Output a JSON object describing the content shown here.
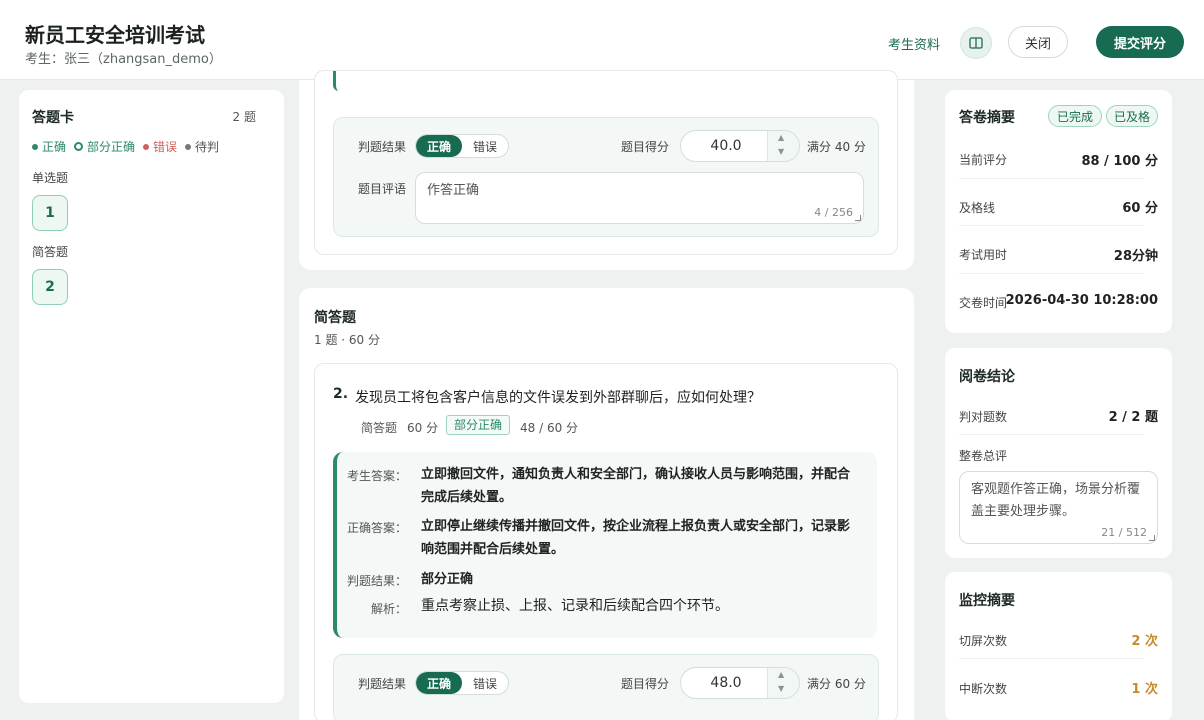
{
  "header": {
    "title": "新员工安全培训考试",
    "subtitle": "考生：张三（zhangsan_demo）",
    "profile_link": "考生资料",
    "close_label": "关闭",
    "submit_label": "提交评分"
  },
  "sidebar": {
    "title": "答题卡",
    "count": "2 题",
    "legend": [
      {
        "label": "正确",
        "color": "#2d8a66"
      },
      {
        "label": "部分正确",
        "color": "#2d8a66"
      },
      {
        "label": "错误",
        "color": "#d0605a"
      },
      {
        "label": "待判",
        "color": "#777777"
      }
    ],
    "sections": [
      {
        "title": "单选题",
        "number": "1"
      },
      {
        "title": "简答题",
        "number": "2"
      }
    ]
  },
  "q1_grading": {
    "result_label": "判题结果",
    "correct": "正确",
    "wrong": "错误",
    "score_label": "题目得分",
    "score_value": "40.0",
    "full_score": "满分 40 分",
    "comment_label": "题目评语",
    "comment_text": "作答正确",
    "comment_count": "4 / 256"
  },
  "short_section": {
    "title": "简答题",
    "meta": "1 题 · 60 分"
  },
  "q2": {
    "number": "2.",
    "text": "发现员工将包含客户信息的文件误发到外部群聊后，应如何处理？",
    "type": "简答题",
    "points": "60 分",
    "status_tag": "部分正确",
    "score": "48 / 60 分",
    "student_answer_label": "考生答案：",
    "student_answer": "立即撤回文件，通知负责人和安全部门，确认接收人员与影响范围，并配合完成后续处置。",
    "correct_answer_label": "正确答案：",
    "correct_answer": "立即停止继续传播并撤回文件，按企业流程上报负责人或安全部门，记录影响范围并配合后续处置。",
    "judge_label": "判题结果：",
    "judge_value": "部分正确",
    "analysis_label": "解析：",
    "analysis": "重点考察止损、上报、记录和后续配合四个环节。"
  },
  "q2_grading": {
    "result_label": "判题结果",
    "correct": "正确",
    "wrong": "错误",
    "score_label": "题目得分",
    "score_value": "48.0",
    "full_score": "满分 60 分"
  },
  "summary": {
    "title": "答卷摘要",
    "tag_done": "已完成",
    "tag_pass": "已及格",
    "rows": [
      {
        "label": "当前评分",
        "value": "88 / 100 分"
      },
      {
        "label": "及格线",
        "value": "60 分"
      },
      {
        "label": "考试用时",
        "value": "28分钟"
      },
      {
        "label": "交卷时间",
        "value": "2026-04-30 10:28:00"
      }
    ]
  },
  "conclusion": {
    "title": "阅卷结论",
    "correct_count_label": "判对题数",
    "correct_count_value": "2 / 2 题",
    "overall_label": "整卷总评",
    "overall_text": "客观题作答正确，场景分析覆盖主要处理步骤。",
    "overall_count": "21 / 512"
  },
  "monitor": {
    "title": "监控摘要",
    "rows": [
      {
        "label": "切屏次数",
        "value": "2 次"
      },
      {
        "label": "中断次数",
        "value": "1 次"
      }
    ],
    "value_color": "#c98a2b"
  }
}
